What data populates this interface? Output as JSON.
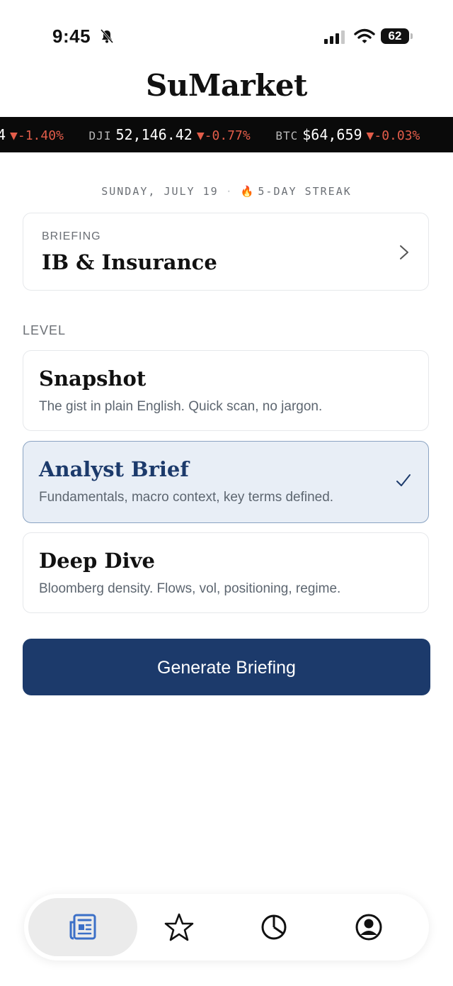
{
  "status_bar": {
    "time": "9:45",
    "battery": "62"
  },
  "app": {
    "title": "SuMarket"
  },
  "ticker": [
    {
      "symbol": "",
      "price": "4",
      "change": "▼-1.40%"
    },
    {
      "symbol": "DJI",
      "price": "52,146.42",
      "change": "▼-0.77%"
    },
    {
      "symbol": "BTC",
      "price": "$64,659",
      "change": "▼-0.03%"
    }
  ],
  "date_line": {
    "date": "SUNDAY, JULY 19",
    "streak": "5-DAY STREAK"
  },
  "briefing": {
    "label": "BRIEFING",
    "value": "IB & Insurance"
  },
  "level": {
    "label": "LEVEL",
    "options": [
      {
        "title": "Snapshot",
        "description": "The gist in plain English. Quick scan, no jargon.",
        "selected": false
      },
      {
        "title": "Analyst Brief",
        "description": "Fundamentals, macro context, key terms defined.",
        "selected": true
      },
      {
        "title": "Deep Dive",
        "description": "Bloomberg density. Flows, vol, positioning, regime.",
        "selected": false
      }
    ]
  },
  "actions": {
    "generate_label": "Generate Briefing"
  },
  "tabs": [
    {
      "icon": "newspaper-icon",
      "active": true
    },
    {
      "icon": "star-icon",
      "active": false
    },
    {
      "icon": "pie-chart-icon",
      "active": false
    },
    {
      "icon": "profile-icon",
      "active": false
    }
  ],
  "colors": {
    "accent": "#1c3a6b",
    "negative": "#e35d4a",
    "ticker_bg": "#0a0a0a",
    "selected_bg": "#e8eef6"
  }
}
